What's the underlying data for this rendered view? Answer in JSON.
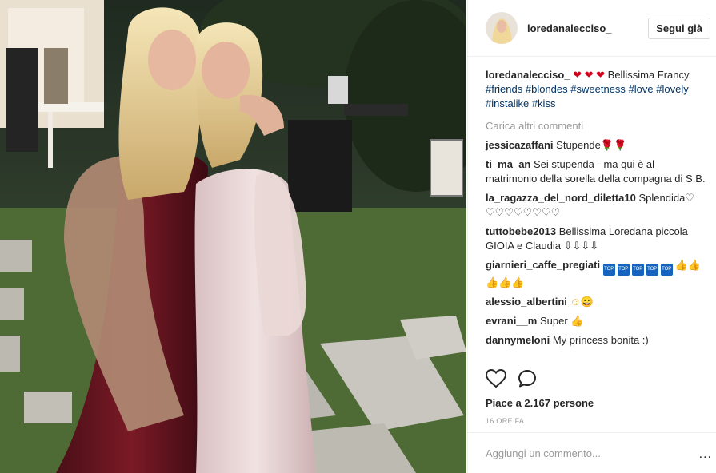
{
  "post": {
    "username": "loredanalecciso_",
    "follow_label": "Segui già",
    "caption_text": "Bellissima Francy.",
    "caption_hearts": "❤ ❤ ❤",
    "hashtags": [
      "#friends",
      "#blondes",
      "#sweetness",
      "#love",
      "#lovely",
      "#instalike",
      "#kiss"
    ],
    "load_more": "Carica altri commenti",
    "likes": "Piace a 2.167 persone",
    "time": "16 ORE FA",
    "add_comment_placeholder": "Aggiungi un commento...",
    "more_icon": "..."
  },
  "comments": [
    {
      "user": "jessicazaffani",
      "text": "Stupende",
      "emoji": "🌹🌹"
    },
    {
      "user": "ti_ma_an",
      "text": "Sei stupenda - ma qui è al matrimonio della sorella della compagna di S.B.",
      "emoji": ""
    },
    {
      "user": "la_ragazza_del_nord_diletta10",
      "text": "Splendida♡ ♡♡♡♡♡♡♡♡",
      "emoji": ""
    },
    {
      "user": "tuttobebe2013",
      "text": "Bellissima Loredana piccola GIOIA e Claudia",
      "emoji": "⇩⇩⇩⇩"
    },
    {
      "user": "giarnieri_caffe_pregiati",
      "text": "",
      "emoji": "👍👍👍👍👍"
    },
    {
      "user": "alessio_albertini",
      "text": "",
      "emoji": "☺😀"
    },
    {
      "user": "evrani__m",
      "text": "Super",
      "emoji": "👍"
    },
    {
      "user": "dannymeloni",
      "text": "My princess bonita :)",
      "emoji": ""
    }
  ],
  "colors": {
    "hashtag": "#003569",
    "heart": "#d0021b",
    "muted": "#999999",
    "border": "#efefef"
  }
}
